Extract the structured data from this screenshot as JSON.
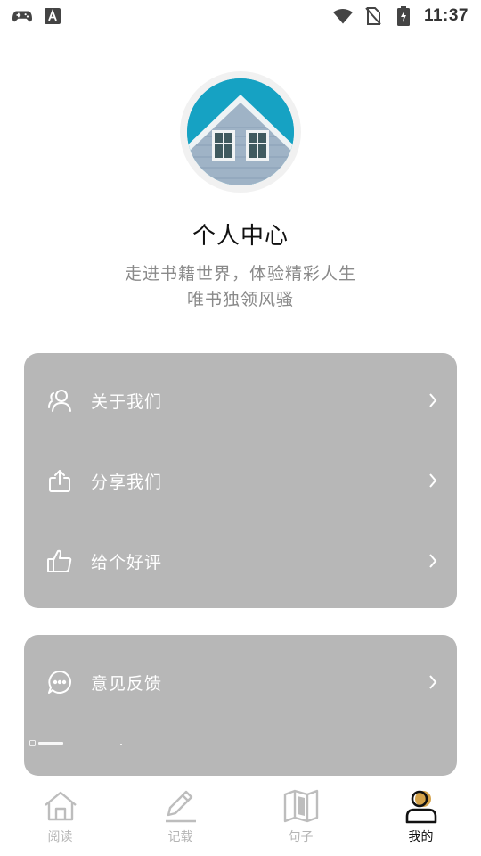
{
  "status_bar": {
    "time": "11:37",
    "left_icons": [
      "gamepad-icon",
      "text-a-icon"
    ],
    "right_icons": [
      "wifi-icon",
      "no-sim-icon",
      "battery-charging-icon"
    ]
  },
  "profile": {
    "avatar_icon": "house-window-photo",
    "title": "个人中心",
    "subtitle_line1": "走进书籍世界，体验精彩人生",
    "subtitle_line2": "唯书独领风骚"
  },
  "menu_group_1": {
    "items": [
      {
        "icon": "users-icon",
        "label": "关于我们"
      },
      {
        "icon": "share-icon",
        "label": "分享我们"
      },
      {
        "icon": "thumbs-up-icon",
        "label": "给个好评"
      }
    ]
  },
  "menu_group_2": {
    "items": [
      {
        "icon": "chat-bubble-icon",
        "label": "意见反馈"
      }
    ]
  },
  "bottom_nav": {
    "items": [
      {
        "icon": "home-icon",
        "label": "阅读",
        "active": false
      },
      {
        "icon": "pen-icon",
        "label": "记载",
        "active": false
      },
      {
        "icon": "book-open-icon",
        "label": "句子",
        "active": false
      },
      {
        "icon": "user-icon",
        "label": "我的",
        "active": true
      }
    ]
  },
  "colors": {
    "card_bg": "#b7b7b7",
    "nav_inactive": "#b5b5b5",
    "nav_active": "#111111",
    "subtitle": "#8a8a8a"
  }
}
